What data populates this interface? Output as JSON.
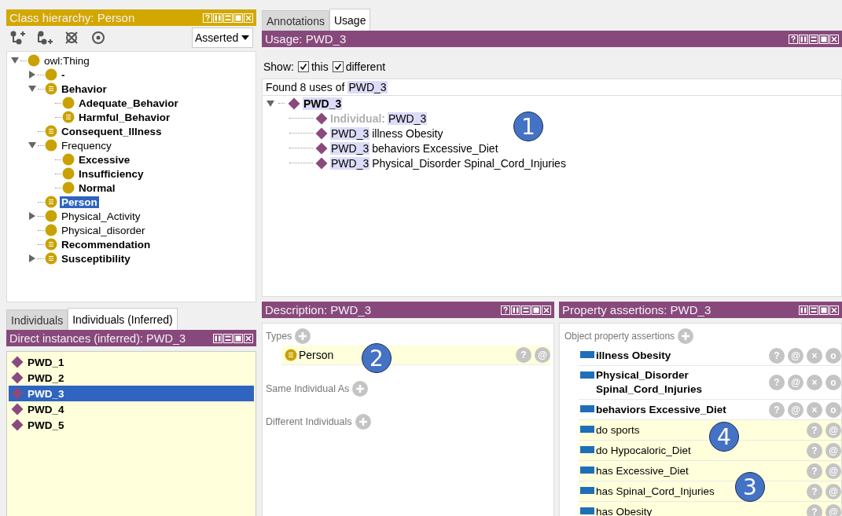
{
  "class_hierarchy": {
    "title": "Class hierarchy: Person",
    "view_mode": "Asserted",
    "tree": [
      {
        "label": "owl:Thing",
        "kind": "class",
        "bold": false,
        "expanded": true,
        "selected": false,
        "children": [
          {
            "label": "-",
            "kind": "class",
            "bold": true,
            "expanded": false,
            "selected": false
          },
          {
            "label": "Behavior",
            "kind": "defined",
            "bold": true,
            "expanded": true,
            "selected": false,
            "children": [
              {
                "label": "Adequate_Behavior",
                "kind": "class",
                "bold": true,
                "selected": false
              },
              {
                "label": "Harmful_Behavior",
                "kind": "defined",
                "bold": true,
                "selected": false
              }
            ]
          },
          {
            "label": "Consequent_Illness",
            "kind": "defined",
            "bold": true,
            "selected": false
          },
          {
            "label": "Frequency",
            "kind": "class",
            "bold": false,
            "expanded": true,
            "selected": false,
            "children": [
              {
                "label": "Excessive",
                "kind": "class",
                "bold": true,
                "selected": false
              },
              {
                "label": "Insufficiency",
                "kind": "class",
                "bold": true,
                "selected": false
              },
              {
                "label": "Normal",
                "kind": "class",
                "bold": true,
                "selected": false
              }
            ]
          },
          {
            "label": "Person",
            "kind": "defined",
            "bold": true,
            "selected": true
          },
          {
            "label": "Physical_Activity",
            "kind": "class",
            "bold": false,
            "expanded": false,
            "selected": false
          },
          {
            "label": "Physical_disorder",
            "kind": "class",
            "bold": false,
            "selected": false
          },
          {
            "label": "Recommendation",
            "kind": "defined",
            "bold": true,
            "selected": false
          },
          {
            "label": "Susceptibility",
            "kind": "defined",
            "bold": true,
            "expanded": false,
            "selected": false
          }
        ]
      }
    ]
  },
  "individuals": {
    "tabs": [
      {
        "label": "Individuals",
        "selected": false
      },
      {
        "label": "Individuals (Inferred)",
        "selected": true
      }
    ],
    "title": "Direct instances (inferred): PWD_3",
    "items": [
      {
        "label": "PWD_1",
        "selected": false
      },
      {
        "label": "PWD_2",
        "selected": false
      },
      {
        "label": "PWD_3",
        "selected": true
      },
      {
        "label": "PWD_4",
        "selected": false
      },
      {
        "label": "PWD_5",
        "selected": false
      }
    ]
  },
  "usage": {
    "tabs": [
      {
        "label": "Annotations",
        "selected": false
      },
      {
        "label": "Usage",
        "selected": true
      }
    ],
    "title": "Usage: PWD_3",
    "show_label": "Show:",
    "filters": [
      {
        "label": "this",
        "checked": true
      },
      {
        "label": "different",
        "checked": true
      }
    ],
    "summary_prefix": "Found 8 uses of",
    "summary_subject": "PWD_3",
    "root": "PWD_3",
    "callout": "1",
    "uses": [
      {
        "kind": "declaration",
        "label": "Individual:",
        "subject": "PWD_3"
      },
      {
        "kind": "assertion",
        "subject": "PWD_3",
        "text": "illness Obesity"
      },
      {
        "kind": "assertion",
        "subject": "PWD_3",
        "text": "behaviors Excessive_Diet"
      },
      {
        "kind": "assertion",
        "subject": "PWD_3",
        "text": "Physical_Disorder Spinal_Cord_Injuries"
      }
    ]
  },
  "description": {
    "title": "Description: PWD_3",
    "callout": "2",
    "sections": [
      {
        "label": "Types",
        "items": [
          {
            "label": "Person",
            "buttons": [
              "?",
              "@"
            ]
          }
        ]
      },
      {
        "label": "Same Individual As"
      },
      {
        "label": "Different Individuals"
      }
    ]
  },
  "property_assertions": {
    "title": "Property assertions: PWD_3",
    "section": "Object property assertions",
    "callouts": [
      "4",
      "3"
    ],
    "rows": [
      {
        "text": "illness  Obesity",
        "inferred": false,
        "buttons": [
          "?",
          "@",
          "×",
          "o"
        ]
      },
      {
        "text": "Physical_Disorder Spinal_Cord_Injuries",
        "inferred": false,
        "buttons": [
          "?",
          "@",
          "×",
          "o"
        ]
      },
      {
        "text": "behaviors  Excessive_Diet",
        "inferred": false,
        "buttons": [
          "?",
          "@",
          "×",
          "o"
        ]
      },
      {
        "text": "do  sports",
        "inferred": true,
        "buttons": [
          "?",
          "@"
        ]
      },
      {
        "text": "do  Hypocaloric_Diet",
        "inferred": true,
        "buttons": [
          "?",
          "@"
        ]
      },
      {
        "text": "has  Excessive_Diet",
        "inferred": true,
        "buttons": [
          "?",
          "@"
        ]
      },
      {
        "text": "has  Spinal_Cord_Injuries",
        "inferred": true,
        "buttons": [
          "?",
          "@"
        ]
      },
      {
        "text": "has  Obesity",
        "inferred": true,
        "buttons": [
          "?",
          "@"
        ]
      }
    ]
  }
}
